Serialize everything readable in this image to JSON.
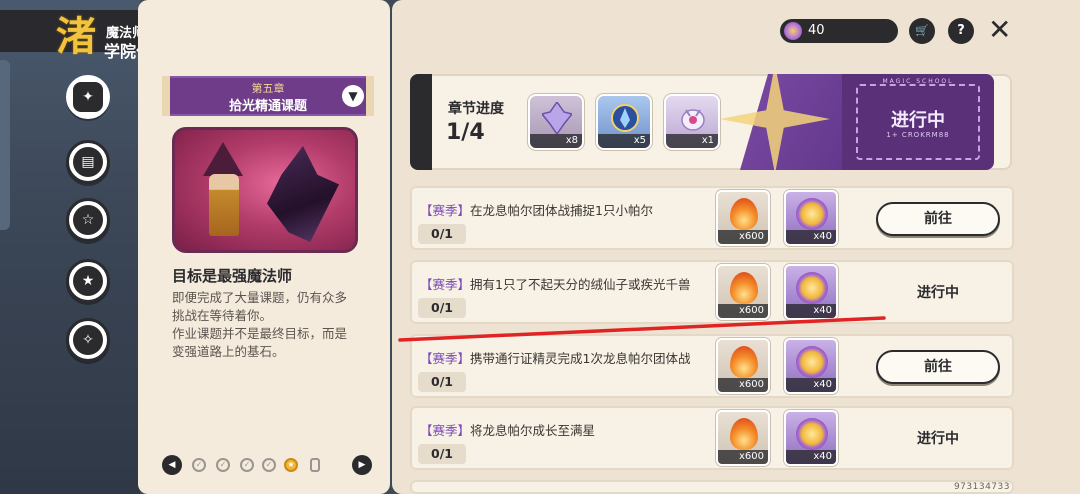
{
  "header": {
    "logo_line1": "魔法师手册",
    "logo_line2": "学院作业",
    "logo_emblem": "渚"
  },
  "sidebar": {
    "items": [
      {
        "icon": "compass-icon",
        "active": true
      },
      {
        "icon": "scroll-icon",
        "active": false
      },
      {
        "icon": "star-bubble-icon",
        "active": false
      },
      {
        "icon": "star-wand-icon",
        "active": false
      },
      {
        "icon": "badge-icon",
        "active": false
      }
    ]
  },
  "chapter": {
    "number": "第五章",
    "title": "拾光精通课题",
    "toggle_icon": "▼",
    "goal_title": "目标是最强魔法师",
    "goal_desc_1": "即便完成了大量课题，仍有众多",
    "goal_desc_2": "挑战在等待着你。",
    "goal_desc_3": "作业课题并不是最终目标，而是",
    "goal_desc_4": "变强道路上的基石。"
  },
  "pager": {
    "prev_icon": "◀",
    "next_icon": "▶",
    "dots": [
      "✓",
      "✓",
      "✓",
      "✓",
      "★"
    ]
  },
  "topbar": {
    "currency_value": "40",
    "cart_icon": "🛒",
    "help_label": "?",
    "close_label": "✕"
  },
  "progress": {
    "label": "章节进度",
    "value": "1/4",
    "rewards": [
      {
        "icon": "crystal-icon",
        "count": "x8"
      },
      {
        "icon": "blue-orb-icon",
        "count": "x5"
      },
      {
        "icon": "spirit-icon",
        "count": "x1"
      }
    ],
    "status": "进行中",
    "status_sub": "1+ CROKRM88",
    "status_top": "MAGIC SCHOOL"
  },
  "tasks": [
    {
      "tag": "【赛季】",
      "text": "在龙息帕尔团体战捕捉1只小帕尔",
      "progress": "0/1",
      "reward1": "x600",
      "reward2": "x40",
      "action": "前往",
      "action_type": "button"
    },
    {
      "tag": "【赛季】",
      "text": "拥有1只了不起天分的绒仙子或疾光千兽",
      "progress": "0/1",
      "reward1": "x600",
      "reward2": "x40",
      "action": "进行中",
      "action_type": "status"
    },
    {
      "tag": "【赛季】",
      "text": "携带通行证精灵完成1次龙息帕尔团体战",
      "progress": "0/1",
      "reward1": "x600",
      "reward2": "x40",
      "action": "前往",
      "action_type": "button"
    },
    {
      "tag": "【赛季】",
      "text": "将龙息帕尔成长至满星",
      "progress": "0/1",
      "reward1": "x600",
      "reward2": "x40",
      "action": "进行中",
      "action_type": "status"
    }
  ],
  "footer": {
    "uid": "973134733"
  },
  "colors": {
    "accent_purple": "#6f3c8a",
    "tag_purple": "#7d4ab7",
    "annotation_red": "#e02424",
    "dark": "#2b2b2e"
  }
}
